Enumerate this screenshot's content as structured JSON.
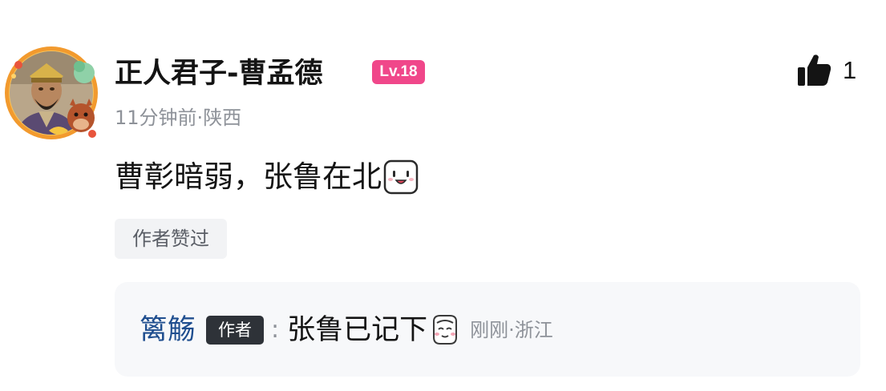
{
  "comment": {
    "avatar_icon": "avatar-cao-cao-festive-frame",
    "username": "正人君子-曹孟德",
    "level": "Lv.18",
    "level_color": "#f0478a",
    "time": "11分钟前",
    "location": "陕西",
    "meta_separator": "·",
    "text": "曹彰暗弱，张鲁在北",
    "emoji_icon": "smiling-face-emoji",
    "like_icon": "thumbs-up-icon",
    "like_count": "1",
    "author_liked_tag": "作者赞过"
  },
  "reply": {
    "name": "篱觞",
    "name_color": "#1f4e8f",
    "author_tag": "作者",
    "separator": ":",
    "text": "张鲁已记下",
    "emoji_icon": "sly-smile-emoji",
    "time": "刚刚",
    "location": "浙江",
    "meta_separator": "·"
  }
}
